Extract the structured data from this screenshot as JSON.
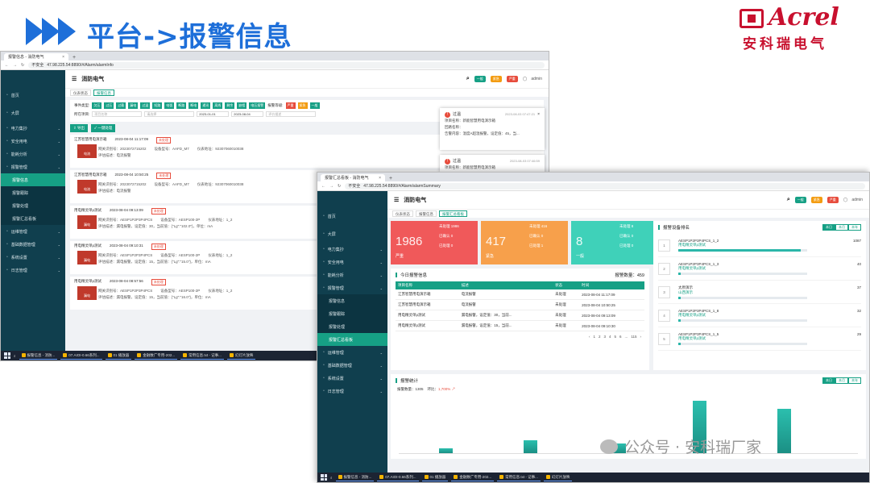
{
  "slide": {
    "title": "平台->报警信息"
  },
  "logo": {
    "en": "Acrel",
    "cn": "安科瑞电气"
  },
  "watermark": "公众号 · 安科瑞厂家",
  "win1": {
    "tab": "报警信息 - 消防电气",
    "url": "47.98.225.54:8890/#/Alarm/alarmInfo",
    "secure": "不安全",
    "app_title": "消防电气",
    "crumbs": [
      "仪表状态",
      "报警信息"
    ],
    "badges": [
      "一般",
      "紧急",
      "严重"
    ],
    "user": "admin",
    "sidebar": [
      "首页",
      "大屏",
      "电力集抄",
      "安全用电",
      "能耗分析",
      "报警管理",
      "报警信息",
      "报警跟踪",
      "报警处理",
      "报警汇总看板",
      "运维管理",
      "基础数据管理",
      "系统设置",
      "日志管理"
    ],
    "filter": {
      "type_label": "事件类型:",
      "types": [
        "欠压",
        "过压",
        "过载",
        "漏电",
        "过温",
        "短路",
        "电弧",
        "断路",
        "断电",
        "通讯",
        "离线",
        "剩余",
        "缺相",
        "电压报警"
      ],
      "level_label": "报警等级:",
      "levels": [
        "严重",
        "紧急",
        "一般"
      ],
      "project_label": "所在项目:",
      "project_ph": "项目名称",
      "device_ph": "请选择",
      "date_from": "2023-01-01",
      "date_to": "2023-08-04",
      "desc_ph": "评价描述"
    },
    "actions": {
      "export": "导出",
      "confirm": "一键处理"
    },
    "cards": [
      {
        "name": "江苏智慧用电演示箱",
        "time": "2023-08-04 11:17:09",
        "status": "未处理",
        "icon": "电流",
        "gw": "网关识别号：2023072715202",
        "dev": "设备型号：AAFD_M7",
        "addr": "仪表地址：92307060010038",
        "desc": "评估描述：电流报警"
      },
      {
        "name": "江苏智慧用电演示箱",
        "time": "2023-08-04 10:50:25",
        "status": "未处理",
        "icon": "电流",
        "gw": "网关识别号：2023072715202",
        "dev": "设备型号：AAFD_M7",
        "addr": "仪表地址：92307060010038",
        "desc": "评估描述：电流报警"
      },
      {
        "name": "用电精灵单p测试",
        "time": "2023-08-04 09:13:09",
        "status": "未处理",
        "icon": "漏电",
        "gw": "网关识别号：AESP1P2P3P4PCS",
        "dev": "设备型号：AESP100-2P",
        "addr": "仪表地址：1_2",
        "desc": "评估描述：漏电报警，设定值：30，当前值：{\"Lg\":\"102.0\"}，单位：mA"
      },
      {
        "name": "用电精灵单p测试",
        "time": "2023-08-04 09:10:31",
        "status": "未处理",
        "icon": "漏电",
        "gw": "网关识别号：AESP1P2P3P4PCS",
        "dev": "设备型号：AESP100-2P",
        "addr": "仪表地址：1_2",
        "desc": "评估描述：漏电报警，设定值：15，当前值：{\"Lg\":\"15.0\"}，单位：mA"
      },
      {
        "name": "用电精灵单p测试",
        "time": "2023-08-04 08:57:56",
        "status": "未处理",
        "icon": "漏电",
        "gw": "网关识别号：AESP1P2P3P4PCS",
        "dev": "设备型号：AESP100-2P",
        "addr": "仪表地址：1_2",
        "desc": "评估描述：漏电报警，设定值：15，当前值：{\"Lg\":\"16.0\"}，单位：mA"
      }
    ],
    "popup1": {
      "title": "过温",
      "time": "2023-08-03 07:47:21",
      "l1": "项目名称：新能智慧用电演示箱",
      "l2": "回路名称：",
      "l3": "告警内容：温度A超温报警，设定值：45，当..."
    },
    "popup2": {
      "title": "过温",
      "time": "2023-08-03 07:46:59",
      "l1": "项目名称：新能智慧用电演示箱"
    }
  },
  "win2": {
    "tab": "报警汇总看板 - 消防电气",
    "url": "47.98.225.54:8890/#/Alarm/alarmSummary",
    "secure": "不安全",
    "app_title": "消防电气",
    "crumbs": [
      "仪表状态",
      "报警信息",
      "报警汇总看板"
    ],
    "sidebar": [
      "首页",
      "大屏",
      "电力集抄",
      "安全用电",
      "能耗分析",
      "报警管理",
      "报警信息",
      "报警跟踪",
      "报警处理",
      "报警汇总看板",
      "运维管理",
      "基础数据管理",
      "系统设置",
      "日志管理"
    ],
    "stats": [
      {
        "num": "1986",
        "label": "严重",
        "a": "未处理 1986",
        "b": "已确认 0",
        "c": "已处理 0",
        "color": "#f0595a"
      },
      {
        "num": "417",
        "label": "紧急",
        "a": "未处理 416",
        "b": "已确认 0",
        "c": "已处理 1",
        "color": "#f7a04b"
      },
      {
        "num": "8",
        "label": "一般",
        "a": "未处理 8",
        "b": "已确认 0",
        "c": "已处理 0",
        "color": "#3fd1b9"
      }
    ],
    "today": {
      "title": "今日报警信息",
      "count": "报警数量：459",
      "cols": [
        "项目名称",
        "描述",
        "状态",
        "时间"
      ],
      "rows": [
        [
          "江苏智慧用电演示箱",
          "电流报警",
          "未处理",
          "2023-08-04 11:17:09"
        ],
        [
          "江苏智慧用电演示箱",
          "电流报警",
          "未处理",
          "2023-08-04 10:50:25"
        ],
        [
          "用电精灵单p测试",
          "漏电报警，设定值：30，当前...",
          "未处理",
          "2023-08-04 09:13:09"
        ],
        [
          "用电精灵单p测试",
          "漏电报警，设定值：15，当前...",
          "未处理",
          "2023-08-04 09:10:30"
        ]
      ],
      "pages": [
        "1",
        "2",
        "3",
        "4",
        "5",
        "6",
        "...",
        "115"
      ]
    },
    "rank": {
      "title": "报警设备排名",
      "tabs": [
        "本日",
        "本月",
        "本年"
      ],
      "items": [
        {
          "n": "1",
          "name": "AESP1P2P3P4PCS_1_2",
          "sub": "用电精灵单p测试",
          "v": "1087",
          "f": 0.95
        },
        {
          "n": "2",
          "name": "AESP1P2P3P4PCS_1_3",
          "sub": "用电精灵单p测试",
          "v": "40",
          "f": 0.02
        },
        {
          "n": "3",
          "name": "太原演示",
          "sub": "山西演示",
          "v": "37",
          "f": 0.02
        },
        {
          "n": "4",
          "name": "AESP1P2P3P4PCS_1_8",
          "sub": "用电精灵单p测试",
          "v": "32",
          "f": 0.02
        },
        {
          "n": "5",
          "name": "AESP1P2P3P4PCS_1_5",
          "sub": "用电精灵单p测试",
          "v": "29",
          "f": 0.02
        }
      ]
    },
    "trend": {
      "title": "报警统计",
      "count": "报警数量：1305",
      "ratio_label": "环比：",
      "ratio": "1,700%",
      "tabs": [
        "本日",
        "本月",
        "本年"
      ]
    },
    "status_url": "47.98.225.54:8890/#/Alarm/alarmSummary"
  },
  "taskbar": [
    "报警信息 - 消防...",
    "07.AIOI-0.66系列...",
    "01 播放器",
    "金融数广专用-202...",
    "常用信息.txt - 记事...",
    "幻灯片放映"
  ]
}
